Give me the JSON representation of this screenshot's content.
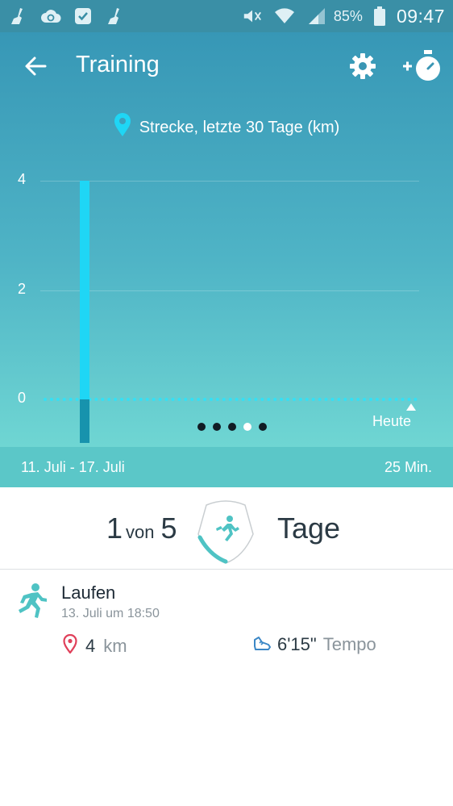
{
  "status_bar": {
    "battery_percent": "85%",
    "time": "09:47"
  },
  "header": {
    "title": "Training"
  },
  "chart_data": {
    "type": "bar",
    "title": "Strecke, letzte 30 Tage (km)",
    "yticks": [
      "0",
      "2",
      "4"
    ],
    "ylim": [
      -0.8,
      4
    ],
    "values": [
      4
    ],
    "x_end_label": "Heute",
    "grid": true
  },
  "pager": {
    "count": 5,
    "active_index": 3
  },
  "week": {
    "range": "11. Juli - 17. Juli",
    "duration": "25 Min."
  },
  "summary": {
    "count": "1",
    "von": "von",
    "total": "5",
    "unit": "Tage"
  },
  "activity": {
    "name": "Laufen",
    "datetime": "13. Juli um 18:50",
    "distance_value": "4",
    "distance_unit": "km",
    "pace_value": "6'15\"",
    "pace_unit": "Tempo"
  },
  "colors": {
    "accent": "#1fd6f5",
    "teal": "#4fc3c4",
    "status_bar": "#3a8fa6",
    "pin_red": "#e0405a"
  }
}
